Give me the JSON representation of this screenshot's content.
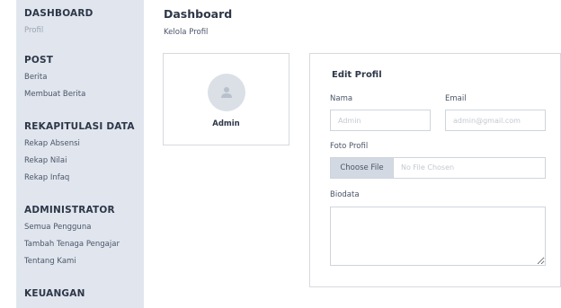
{
  "sidebar": {
    "sections": [
      {
        "heading": "DASHBOARD",
        "items": [
          "Profil"
        ]
      },
      {
        "heading": "POST",
        "items": [
          "Berita",
          "Membuat Berita"
        ]
      },
      {
        "heading": "REKAPITULASI DATA",
        "items": [
          "Rekap Absensi",
          "Rekap Nilai",
          "Rekap Infaq"
        ]
      },
      {
        "heading": "ADMINISTRATOR",
        "items": [
          "Semua Pengguna",
          "Tambah Tenaga Pengajar",
          "Tentang Kami"
        ]
      },
      {
        "heading": "KEUANGAN",
        "items": []
      }
    ]
  },
  "header": {
    "title": "Dashboard",
    "subtitle": "Kelola Profil"
  },
  "profile_card": {
    "avatar_icon": "user-icon",
    "name": "Admin"
  },
  "edit_profile": {
    "title": "Edit Profil",
    "name_label": "Nama",
    "name_placeholder": "Admin",
    "email_label": "Email",
    "email_placeholder": "admin@gmail.com",
    "photo_label": "Foto Profil",
    "choose_file_label": "Choose File",
    "no_file_text": "No File Chosen",
    "bio_label": "Biodata",
    "bio_value": ""
  }
}
